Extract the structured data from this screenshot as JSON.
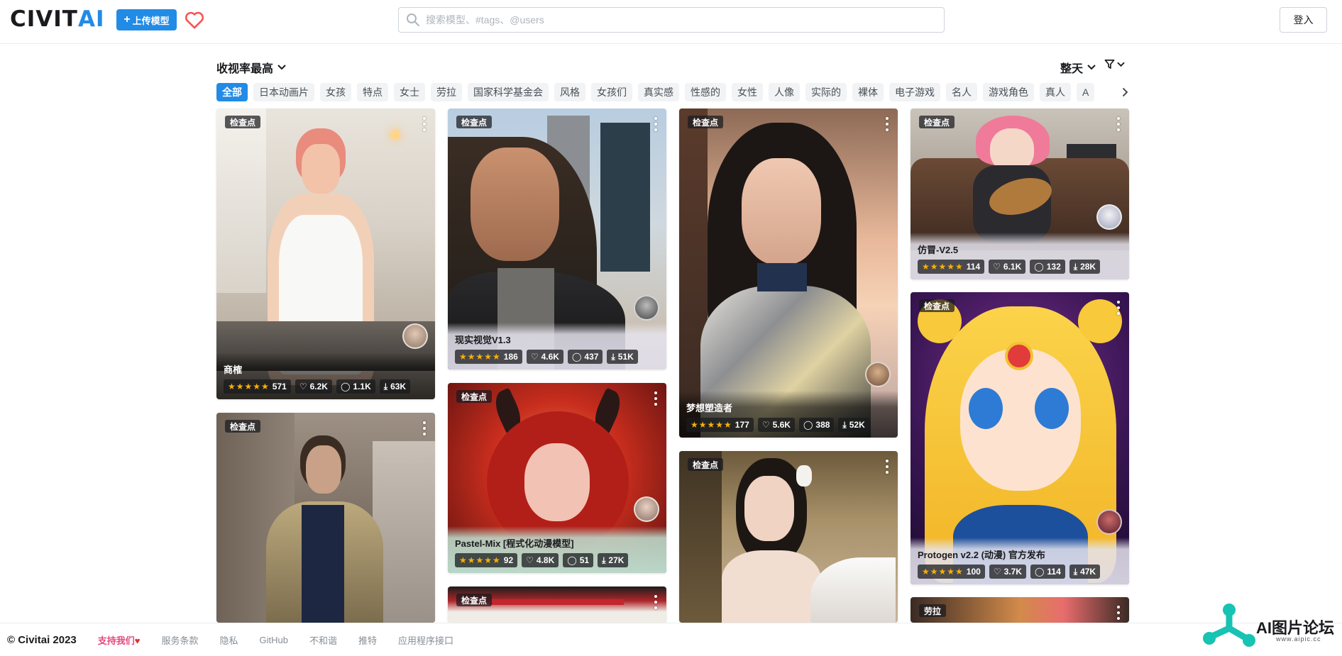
{
  "header": {
    "logo_left": "CIVIT",
    "logo_right": "AI",
    "upload_label": "上传模型",
    "search_placeholder": "搜索模型、#tags、@users",
    "login_label": "登入"
  },
  "toolbar": {
    "sort_label": "收视率最高",
    "period_label": "整天"
  },
  "tags": [
    "全部",
    "日本动画片",
    "女孩",
    "特点",
    "女士",
    "劳拉",
    "国家科学基金会",
    "风格",
    "女孩们",
    "真实感",
    "性感的",
    "女性",
    "人像",
    "实际的",
    "裸体",
    "电子游戏",
    "名人",
    "游戏角色",
    "真人",
    "A"
  ],
  "cards": [
    {
      "badge": "检查点",
      "title": "商榷",
      "rating": "571",
      "likes": "6.2K",
      "comments": "1.1K",
      "downloads": "63K"
    },
    {
      "badge": "检查点",
      "title": "",
      "rating": "",
      "likes": "",
      "comments": "",
      "downloads": ""
    },
    {
      "badge": "检查点",
      "title": "现实视觉V1.3",
      "rating": "186",
      "likes": "4.6K",
      "comments": "437",
      "downloads": "51K"
    },
    {
      "badge": "检查点",
      "title": "Pastel-Mix [程式化动漫模型]",
      "rating": "92",
      "likes": "4.8K",
      "comments": "51",
      "downloads": "27K"
    },
    {
      "badge": "检查点",
      "title": "",
      "rating": "",
      "likes": "",
      "comments": "",
      "downloads": ""
    },
    {
      "badge": "检查点",
      "title": "梦想塑造者",
      "rating": "177",
      "likes": "5.6K",
      "comments": "388",
      "downloads": "52K"
    },
    {
      "badge": "检查点",
      "title": "",
      "rating": "",
      "likes": "",
      "comments": "",
      "downloads": ""
    },
    {
      "badge": "检查点",
      "title": "仿冒-V2.5",
      "rating": "114",
      "likes": "6.1K",
      "comments": "132",
      "downloads": "28K"
    },
    {
      "badge": "检查点",
      "title": "Protogen v2.2 (动漫) 官方发布",
      "rating": "100",
      "likes": "3.7K",
      "comments": "114",
      "downloads": "47K"
    },
    {
      "badge": "劳拉",
      "title": "",
      "rating": "",
      "likes": "",
      "comments": "",
      "downloads": ""
    }
  ],
  "stars": "★★★★★",
  "footer": {
    "copyright": "© Civitai 2023",
    "support": "支持我们",
    "links": [
      "服务条款",
      "隐私",
      "GitHub",
      "不和谐",
      "推特",
      "应用程序接口"
    ]
  },
  "watermark": {
    "title": "AI图片论坛",
    "url": "www.aipic.cc"
  },
  "colors": {
    "accent": "#228be6",
    "heart": "#fa5252",
    "star": "#fab005",
    "support": "#e64980"
  }
}
